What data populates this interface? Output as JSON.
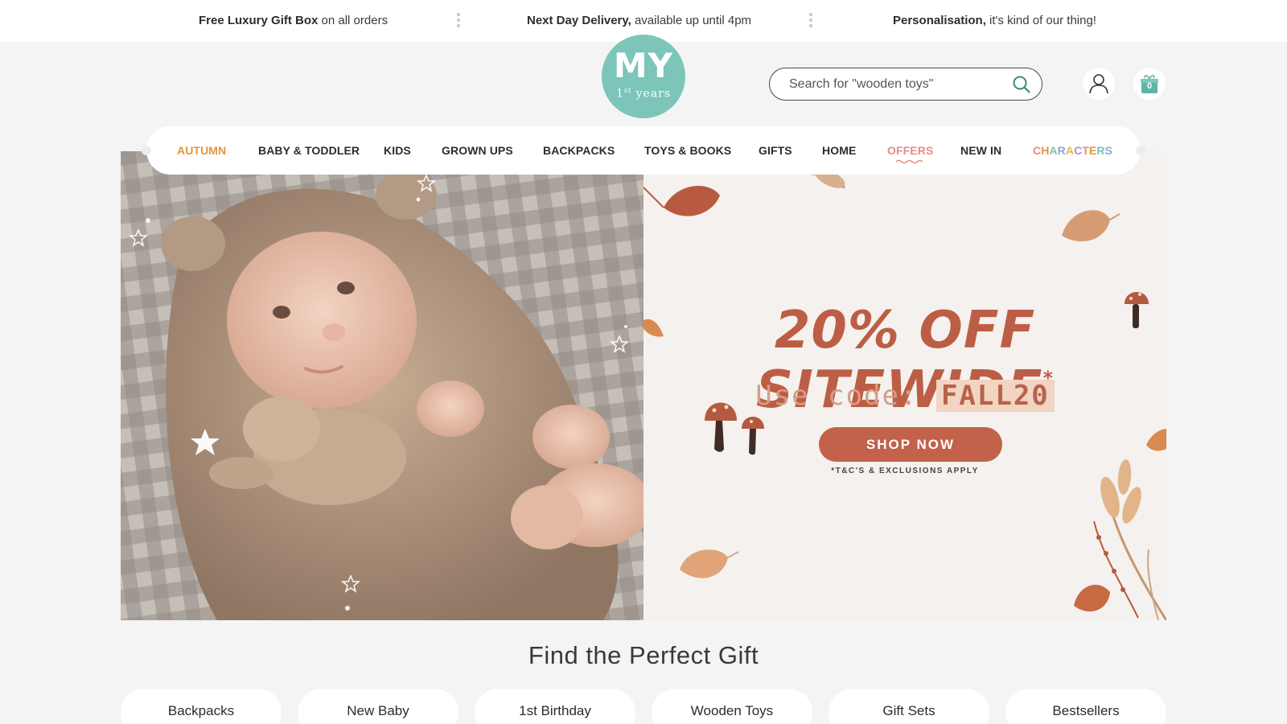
{
  "announcements": [
    {
      "bold": "Free Luxury Gift Box",
      "rest": " on all orders"
    },
    {
      "bold": "Next Day Delivery,",
      "rest": " available up until 4pm"
    },
    {
      "bold": "Personalisation,",
      "rest": " it's kind of our thing!"
    }
  ],
  "logo": {
    "main": "MY",
    "sub_prefix": "1",
    "sub_sup": "st",
    "sub_suffix": " years"
  },
  "search": {
    "placeholder": "Search for \"wooden toys\""
  },
  "account_icon": "user-icon",
  "bag": {
    "icon": "gift-bag-icon",
    "count": "0"
  },
  "nav": {
    "items": [
      "AUTUMN",
      "BABY & TODDLER",
      "KIDS",
      "GROWN UPS",
      "BACKPACKS",
      "TOYS & BOOKS",
      "GIFTS",
      "HOME",
      "OFFERS",
      "NEW IN"
    ],
    "characters": "CHARACTERS"
  },
  "hero": {
    "title": "20% OFF SITEWIDE",
    "asterisk": "*",
    "code_label": "Use code:",
    "code": "FALL20",
    "cta": "SHOP NOW",
    "terms": "*T&C'S & EXCLUSIONS APPLY"
  },
  "gift_section": {
    "title": "Find the Perfect Gift",
    "categories": [
      "Backpacks",
      "New Baby",
      "1st Birthday",
      "Wooden Toys",
      "Gift Sets",
      "Bestsellers"
    ]
  },
  "colors": {
    "accent_teal": "#7cc5b8",
    "promo_red": "#bc5e45",
    "autumn_orange": "#e6953c",
    "offers_pink": "#ea8a8a"
  }
}
